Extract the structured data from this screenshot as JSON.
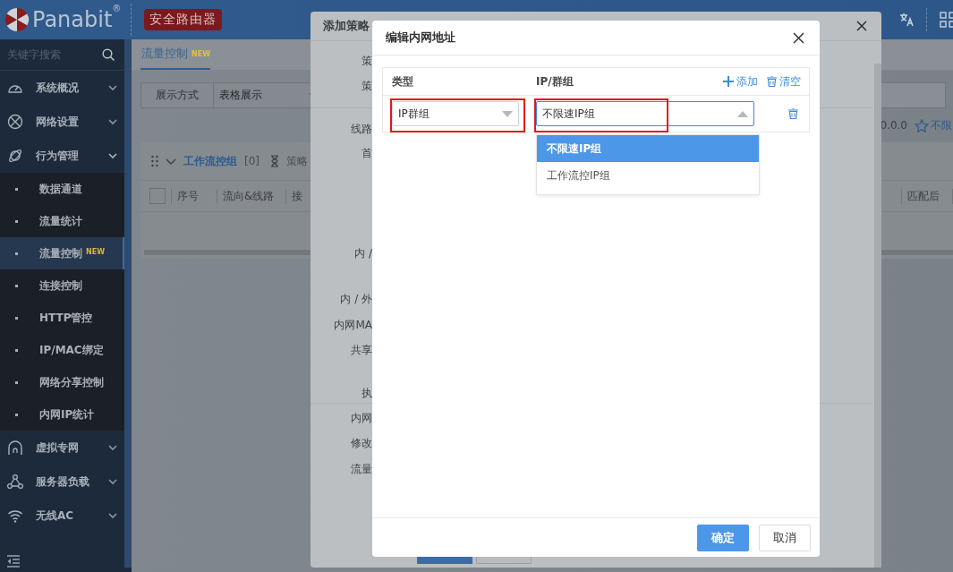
{
  "header": {
    "logo": "Panabit",
    "logo_mark": "®",
    "product_badge": "安全路由器"
  },
  "sidebar": {
    "search_placeholder": "关键字搜索",
    "items": [
      {
        "label": "系统概况",
        "expanded": false
      },
      {
        "label": "网络设置",
        "expanded": false
      },
      {
        "label": "行为管理",
        "expanded": true,
        "children": [
          {
            "label": "数据通道",
            "selected": false
          },
          {
            "label": "流量统计",
            "selected": false
          },
          {
            "label": "流量控制",
            "selected": true,
            "badge": "NEW"
          },
          {
            "label": "连接控制",
            "selected": false
          },
          {
            "label": "HTTP管控",
            "selected": false
          },
          {
            "label": "IP/MAC绑定",
            "selected": false
          },
          {
            "label": "网络分享控制",
            "selected": false
          },
          {
            "label": "内网IP统计",
            "selected": false
          }
        ]
      },
      {
        "label": "虚拟专网",
        "expanded": false
      },
      {
        "label": "服务器负载",
        "expanded": false
      },
      {
        "label": "无线AC",
        "expanded": false
      }
    ]
  },
  "tabs": [
    {
      "label": "流量控制",
      "badge": "NEW",
      "selected": true
    }
  ],
  "filter": {
    "label": "展示方式",
    "value": "表格展示"
  },
  "info": {
    "address": "0.0.0",
    "limit": "不限"
  },
  "panel": {
    "select_all_checked": false,
    "group_name": "工作流控组",
    "count": "[0]",
    "status_label": "策略",
    "columns": [
      "序号",
      "流向&线路",
      "接"
    ],
    "right_columns": [
      "匹配后"
    ]
  },
  "policy_dialog": {
    "title": "添加策略",
    "labels": [
      "策",
      "策",
      "线路",
      "首",
      "内 /",
      "内 / 外",
      "内网MA",
      "共享",
      "执",
      "内网",
      "修改",
      "流量"
    ]
  },
  "address_dialog": {
    "title": "编辑内网地址",
    "columns": [
      "类型",
      "IP/群组"
    ],
    "add_label": "添加",
    "clear_label": "清空",
    "rows": [
      {
        "type": {
          "value": "IP群组",
          "open": false,
          "highlighted": true
        },
        "group": {
          "value": "不限速IP组",
          "open": true,
          "highlighted": true
        }
      }
    ],
    "options": [
      {
        "label": "不限速IP组",
        "selected": true
      },
      {
        "label": "工作流控IP组",
        "selected": false
      }
    ],
    "buttons": [
      {
        "label": "确定",
        "kind": "primary"
      },
      {
        "label": "取消",
        "kind": "default"
      }
    ]
  }
}
